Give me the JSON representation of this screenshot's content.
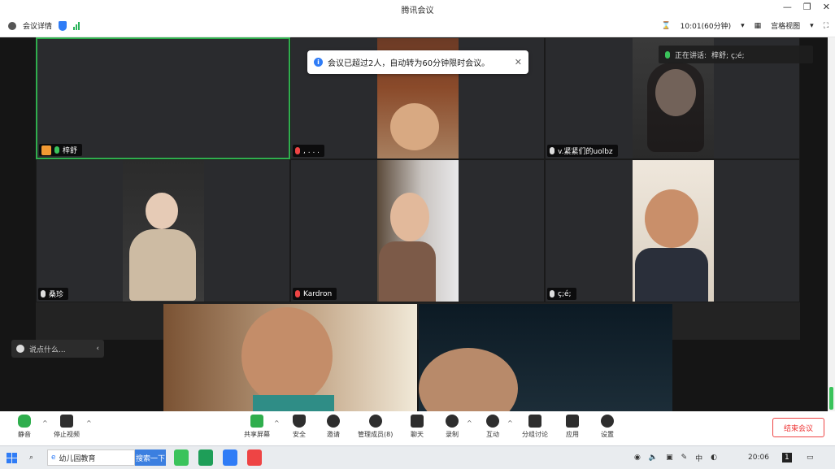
{
  "window": {
    "title": "腾讯会议"
  },
  "topbar": {
    "meeting_info": "会议详情",
    "timer": "10:01(60分钟)",
    "view_mode": "宫格视图"
  },
  "toast": {
    "message": "会议已超过2人，自动转为60分钟限时会议。"
  },
  "speaking": {
    "label": "正在讲话:",
    "names": "梓舒; ç;é;"
  },
  "participants": [
    {
      "name": "梓舒"
    },
    {
      "name": ", . . ."
    },
    {
      "name": "v.紧紧们的uolbz"
    },
    {
      "name": "桑珍"
    },
    {
      "name": "Kardron"
    },
    {
      "name": "ç;é;"
    }
  ],
  "chat": {
    "placeholder": "说点什么..."
  },
  "controls": {
    "mute": "静音",
    "stop_video": "停止视频",
    "share_screen": "共享屏幕",
    "security": "安全",
    "invite": "邀请",
    "manage_members": "管理成员(8)",
    "chat": "聊天",
    "record": "录制",
    "interact": "互动",
    "breakout": "分组讨论",
    "apps": "应用",
    "settings": "设置",
    "end_meeting": "结束会议"
  },
  "taskbar": {
    "browser_tab": "幼儿园教育",
    "search_btn": "搜索一下",
    "clock": "20:06",
    "badge": "1"
  }
}
